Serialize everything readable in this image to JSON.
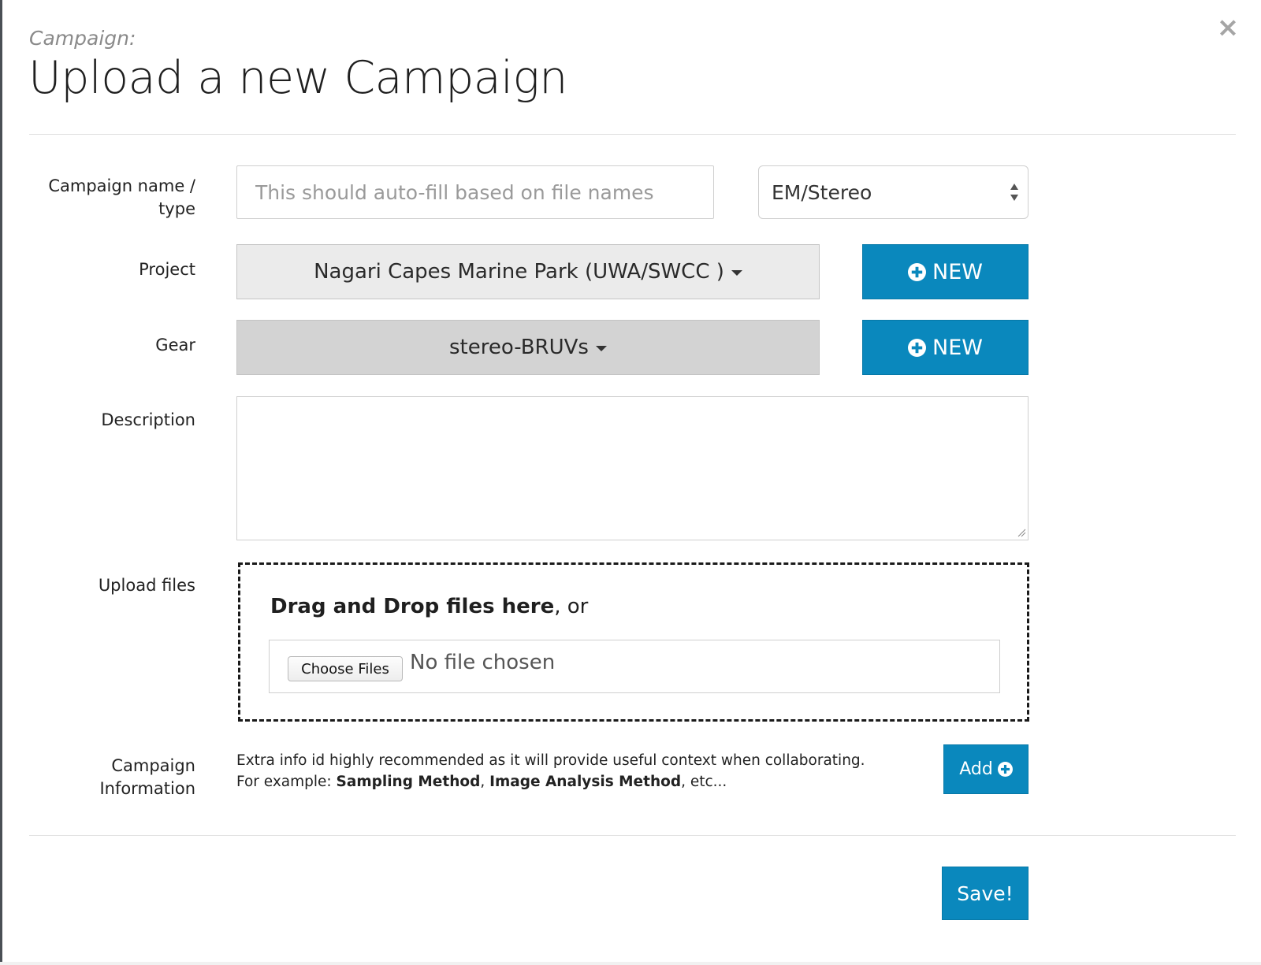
{
  "header": {
    "subtitle": "Campaign:",
    "title": "Upload a new Campaign",
    "close_symbol": "×"
  },
  "form": {
    "campaign_name": {
      "label_line1": "Campaign name /",
      "label_line2": "type",
      "placeholder": "This should auto-fill based on file names",
      "value": ""
    },
    "campaign_type": {
      "selected": "EM/Stereo"
    },
    "project": {
      "label": "Project",
      "selected": "Nagari Capes Marine Park (UWA/SWCC )",
      "new_button": "NEW"
    },
    "gear": {
      "label": "Gear",
      "selected": "stereo-BRUVs",
      "new_button": "NEW"
    },
    "description": {
      "label": "Description",
      "value": ""
    },
    "upload": {
      "label": "Upload files",
      "drop_bold": "Drag and Drop files here",
      "drop_rest": ", or",
      "choose_button": "Choose Files",
      "no_file_text": "No file chosen"
    },
    "campaign_info": {
      "label_line1": "Campaign",
      "label_line2": "Information",
      "line1": "Extra info id highly recommended as it will provide useful context when collaborating.",
      "line2_prefix": "For example: ",
      "example1": "Sampling Method",
      "sep": ", ",
      "example2": "Image Analysis Method",
      "line2_suffix": ", etc...",
      "add_button": "Add"
    }
  },
  "footer": {
    "save_button": "Save!"
  },
  "colors": {
    "primary": "#0a88bd",
    "project_dropdown_bg": "#ebebeb",
    "gear_dropdown_bg": "#d3d3d3"
  },
  "icons": {
    "close": "close-icon",
    "new": "plus-circle-icon",
    "select": "up-down-arrows-icon",
    "dropdown": "caret-down-icon"
  }
}
